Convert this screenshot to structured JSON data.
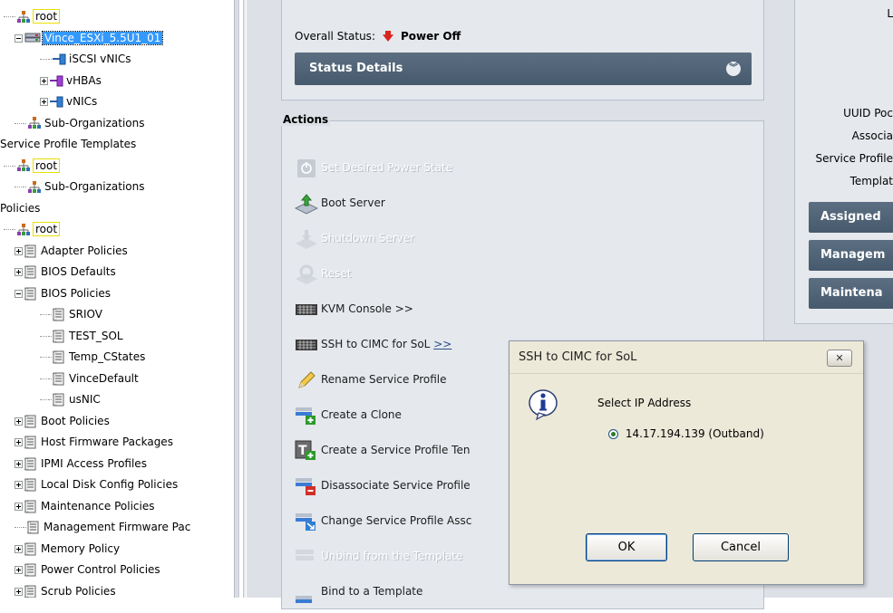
{
  "tree": {
    "rows": [
      {
        "label": "root",
        "type": "org",
        "indent": 0,
        "expander": "none",
        "style": "yellow"
      },
      {
        "label": "Vince_ESXi_5.5U1_01",
        "type": "server",
        "indent": 1,
        "expander": "minus",
        "style": "selected"
      },
      {
        "label": "iSCSI vNICs",
        "type": "nic",
        "indent": 2,
        "expander": "none",
        "style": ""
      },
      {
        "label": "vHBAs",
        "type": "hba",
        "indent": 2,
        "expander": "plus",
        "style": ""
      },
      {
        "label": "vNICs",
        "type": "nic",
        "indent": 2,
        "expander": "plus",
        "style": ""
      },
      {
        "label": "Sub-Organizations",
        "type": "org",
        "indent": 1,
        "expander": "none",
        "style": ""
      },
      {
        "label": "Service Profile Templates",
        "type": "text",
        "indent": 0,
        "expander": "none",
        "style": ""
      },
      {
        "label": "root",
        "type": "org",
        "indent": 0,
        "expander": "none",
        "style": "yellow"
      },
      {
        "label": "Sub-Organizations",
        "type": "org",
        "indent": 1,
        "expander": "none",
        "style": ""
      },
      {
        "label": "Policies",
        "type": "text",
        "indent": 0,
        "expander": "none",
        "style": ""
      },
      {
        "label": "root",
        "type": "org",
        "indent": 0,
        "expander": "none",
        "style": "yellow"
      },
      {
        "label": "Adapter Policies",
        "type": "policy",
        "indent": 1,
        "expander": "plus",
        "style": ""
      },
      {
        "label": "BIOS Defaults",
        "type": "policy",
        "indent": 1,
        "expander": "plus",
        "style": ""
      },
      {
        "label": "BIOS Policies",
        "type": "policy",
        "indent": 1,
        "expander": "minus",
        "style": ""
      },
      {
        "label": "SRIOV",
        "type": "policy",
        "indent": 2,
        "expander": "none",
        "style": ""
      },
      {
        "label": "TEST_SOL",
        "type": "policy",
        "indent": 2,
        "expander": "none",
        "style": ""
      },
      {
        "label": "Temp_CStates",
        "type": "policy",
        "indent": 2,
        "expander": "none",
        "style": ""
      },
      {
        "label": "VinceDefault",
        "type": "policy",
        "indent": 2,
        "expander": "none",
        "style": ""
      },
      {
        "label": "usNIC",
        "type": "policy",
        "indent": 2,
        "expander": "none",
        "style": ""
      },
      {
        "label": "Boot Policies",
        "type": "policy",
        "indent": 1,
        "expander": "plus",
        "style": ""
      },
      {
        "label": "Host Firmware Packages",
        "type": "policy",
        "indent": 1,
        "expander": "plus",
        "style": ""
      },
      {
        "label": "IPMI Access Profiles",
        "type": "policy",
        "indent": 1,
        "expander": "plus",
        "style": ""
      },
      {
        "label": "Local Disk Config Policies",
        "type": "policy",
        "indent": 1,
        "expander": "plus",
        "style": ""
      },
      {
        "label": "Maintenance Policies",
        "type": "policy",
        "indent": 1,
        "expander": "plus",
        "style": ""
      },
      {
        "label": "Management Firmware Pac",
        "type": "policy",
        "indent": 1,
        "expander": "none",
        "style": ""
      },
      {
        "label": "Memory Policy",
        "type": "policy",
        "indent": 1,
        "expander": "plus",
        "style": ""
      },
      {
        "label": "Power Control Policies",
        "type": "policy",
        "indent": 1,
        "expander": "plus",
        "style": ""
      },
      {
        "label": "Scrub Policies",
        "type": "policy",
        "indent": 1,
        "expander": "plus",
        "style": ""
      }
    ]
  },
  "status": {
    "overall_label": "Overall Status:",
    "overall_value": "Power Off",
    "details_label": "Status Details"
  },
  "actions": {
    "legend": "Actions",
    "items": [
      {
        "label": "Set Desired Power State",
        "icon": "power-icon",
        "enabled": false
      },
      {
        "label": "Boot Server",
        "icon": "boot-server-icon",
        "enabled": true
      },
      {
        "label": "Shutdown Server",
        "icon": "shutdown-server-icon",
        "enabled": false
      },
      {
        "label": "Reset",
        "icon": "reset-icon",
        "enabled": false
      },
      {
        "label": "KVM Console >>",
        "icon": "keyboard-icon",
        "enabled": true
      },
      {
        "label": "SSH to CIMC for SoL",
        "link": ">>",
        "icon": "keyboard-icon",
        "enabled": true
      },
      {
        "label": "Rename Service Profile",
        "icon": "pencil-icon",
        "enabled": true
      },
      {
        "label": "Create a Clone",
        "icon": "clone-icon",
        "enabled": true
      },
      {
        "label": "Create a Service Profile Ten",
        "icon": "template-icon",
        "enabled": true
      },
      {
        "label": "Disassociate Service Profile",
        "icon": "disassociate-icon",
        "enabled": true
      },
      {
        "label": "Change Service Profile Assc",
        "icon": "change-association-icon",
        "enabled": true
      },
      {
        "label": "Unbind from the Template",
        "icon": "unbind-icon",
        "enabled": false
      },
      {
        "label": "Bind to a Template",
        "icon": "bind-icon",
        "enabled": true
      }
    ]
  },
  "info": {
    "labels": [
      "L",
      "UUID Poc",
      "Associa",
      "Service Profile",
      "Templat"
    ],
    "buttons": [
      "Assigned",
      "Managem",
      "Maintena"
    ]
  },
  "dialog": {
    "title": "SSH to CIMC for SoL",
    "close": "✕",
    "prompt": "Select IP Address",
    "option": "14.17.194.139 (Outband)",
    "ok": "OK",
    "cancel": "Cancel"
  },
  "colors": {
    "selection": "#3399ff",
    "panel_header": "#4f6276",
    "power_off": "#d7261e"
  }
}
